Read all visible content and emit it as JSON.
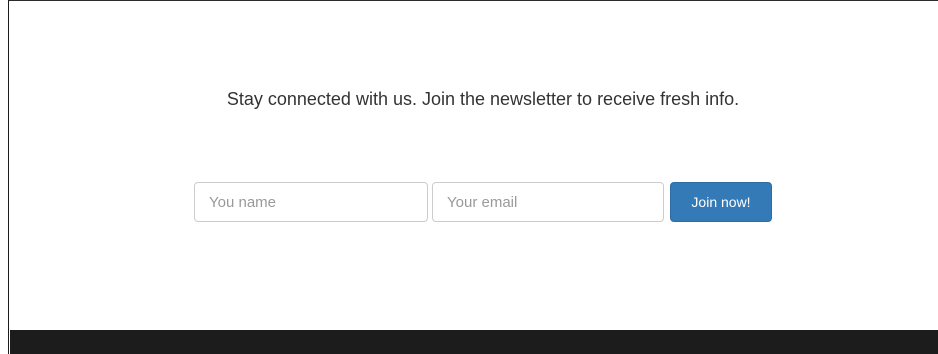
{
  "newsletter": {
    "tagline": "Stay connected with us. Join the newsletter to receive fresh info.",
    "name_placeholder": "You name",
    "email_placeholder": "Your email",
    "join_label": "Join now!"
  },
  "colors": {
    "button_background": "#337ab7",
    "footer_background": "#1c1c1c",
    "text": "#333333"
  }
}
